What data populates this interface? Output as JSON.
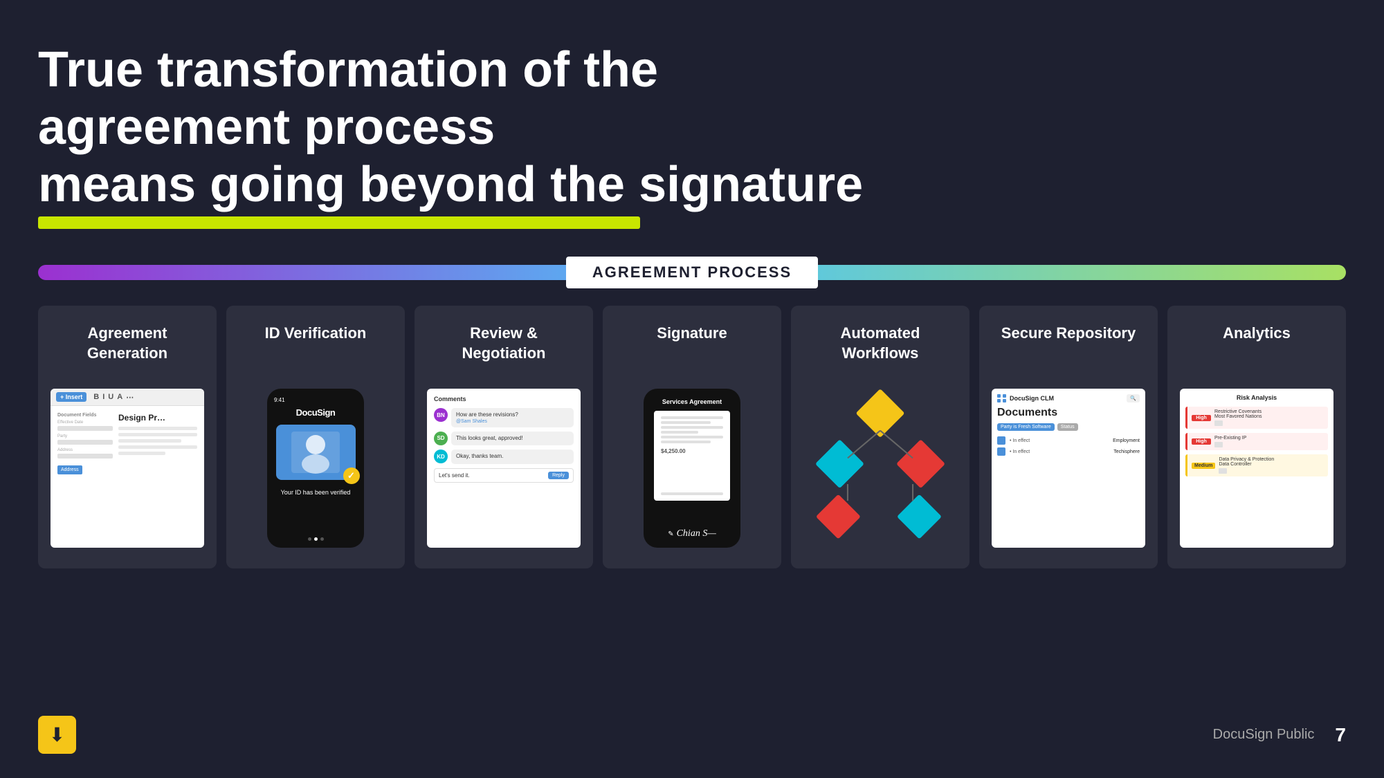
{
  "slide": {
    "title_line1": "True transformation of the agreement process",
    "title_line2": "means going beyond the signature",
    "process_bar_label": "AGREEMENT PROCESS",
    "footer_brand": "DocuSign Public",
    "footer_page": "7"
  },
  "cards": [
    {
      "id": "agreement-generation",
      "title": "Agreement Generation",
      "mock_type": "ag"
    },
    {
      "id": "id-verification",
      "title": "ID Verification",
      "mock_type": "idv"
    },
    {
      "id": "review-negotiation",
      "title": "Review & Negotiation",
      "mock_type": "rn"
    },
    {
      "id": "signature",
      "title": "Signature",
      "mock_type": "sig"
    },
    {
      "id": "automated-workflows",
      "title": "Automated Workflows",
      "mock_type": "aw"
    },
    {
      "id": "secure-repository",
      "title": "Secure Repository",
      "mock_type": "sr"
    },
    {
      "id": "analytics",
      "title": "Analytics",
      "mock_type": "an"
    }
  ],
  "review_negotiation": {
    "section_label": "Comments",
    "comment1_text": "How are these revisions?",
    "comment1_sub": "@Sam Shales",
    "comment2_text": "This looks great, approved!",
    "comment3_text": "Okay, thanks team.",
    "input_text": "Let's send it.",
    "reply_btn": "Reply"
  },
  "id_verification": {
    "time": "9:41",
    "logo": "DocuSign",
    "verified_text": "Your ID has been verified"
  },
  "signature": {
    "doc_title": "Services Agreement",
    "price": "$4,250.00"
  },
  "secure_repository": {
    "logo_text": "DocuSign CLM",
    "search_placeholder": "Search",
    "doc_title": "Documents",
    "tag1": "Party is Fresh Software",
    "tag2": "Status",
    "row1_label": "• In effect",
    "row1_value": "Employment",
    "row2_label": "• In effect",
    "row2_value": "Techisphere"
  },
  "analytics": {
    "title": "Risk Analysis",
    "row1_badge": "High",
    "row1_text": "Restrictive Covenants\nMost Favored Nations",
    "row2_badge": "High",
    "row2_text": "Pre-Existing IP",
    "row3_badge": "Medium",
    "row3_text": "Data Privacy & Protection\nData Controller"
  }
}
